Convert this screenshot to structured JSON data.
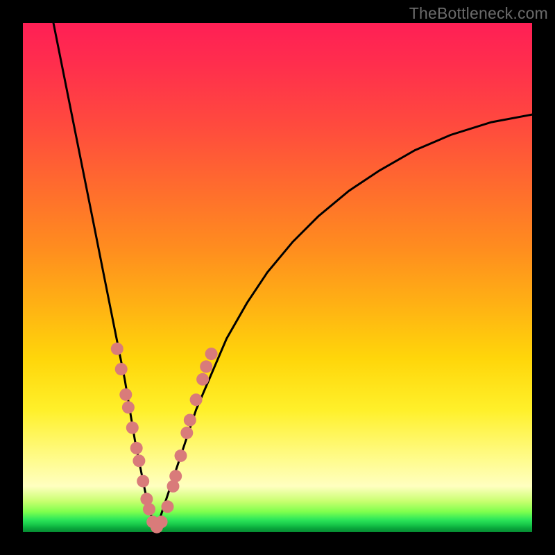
{
  "watermark": "TheBottleneck.com",
  "colors": {
    "frame": "#000000",
    "curve_stroke": "#000000",
    "dot_fill": "#d97b7a",
    "gradient_stops": [
      "#ff1f55",
      "#ff2e4d",
      "#ff4a3e",
      "#ff6b2e",
      "#ff8c1f",
      "#ffb014",
      "#ffd60a",
      "#fff02a",
      "#fffb85",
      "#ffffc0",
      "#c7ff6e",
      "#7fff4e",
      "#2fe85a",
      "#18c94a",
      "#0aa93c",
      "#068a31"
    ]
  },
  "chart_data": {
    "type": "line",
    "title": "",
    "xlabel": "",
    "ylabel": "",
    "xlim": [
      0,
      100
    ],
    "ylim": [
      0,
      100
    ],
    "grid": false,
    "note": "x/y in percent of plot area; y=100 top, y=0 bottom. V-shaped bottleneck curve with minimum near x≈26.",
    "series": [
      {
        "name": "left-branch",
        "x": [
          6,
          8,
          10,
          12,
          14,
          16,
          18,
          20,
          21,
          22,
          23,
          24,
          25,
          25.5,
          26
        ],
        "y": [
          100,
          90,
          80,
          70,
          60,
          50,
          40,
          30,
          24,
          18,
          13,
          8,
          4,
          2,
          0.7
        ]
      },
      {
        "name": "right-branch",
        "x": [
          26,
          27,
          28,
          30,
          32,
          34,
          37,
          40,
          44,
          48,
          53,
          58,
          64,
          70,
          77,
          84,
          92,
          100
        ],
        "y": [
          0.7,
          3,
          6,
          12,
          18,
          24,
          31,
          38,
          45,
          51,
          57,
          62,
          67,
          71,
          75,
          78,
          80.5,
          82
        ]
      }
    ],
    "dots": {
      "name": "highlighted-points",
      "note": "salmon dots clustered near the trough on both branches",
      "points": [
        {
          "x": 18.5,
          "y": 36
        },
        {
          "x": 19.3,
          "y": 32
        },
        {
          "x": 20.2,
          "y": 27
        },
        {
          "x": 20.7,
          "y": 24.5
        },
        {
          "x": 21.5,
          "y": 20.5
        },
        {
          "x": 22.3,
          "y": 16.5
        },
        {
          "x": 22.8,
          "y": 14
        },
        {
          "x": 23.6,
          "y": 10
        },
        {
          "x": 24.3,
          "y": 6.5
        },
        {
          "x": 24.8,
          "y": 4.5
        },
        {
          "x": 25.5,
          "y": 2
        },
        {
          "x": 26.3,
          "y": 1
        },
        {
          "x": 27.2,
          "y": 2
        },
        {
          "x": 28.4,
          "y": 5
        },
        {
          "x": 29.5,
          "y": 9
        },
        {
          "x": 30.0,
          "y": 11
        },
        {
          "x": 31.0,
          "y": 15
        },
        {
          "x": 32.2,
          "y": 19.5
        },
        {
          "x": 32.8,
          "y": 22
        },
        {
          "x": 34.0,
          "y": 26
        },
        {
          "x": 35.3,
          "y": 30
        },
        {
          "x": 36.0,
          "y": 32.5
        },
        {
          "x": 37.0,
          "y": 35
        }
      ]
    }
  }
}
